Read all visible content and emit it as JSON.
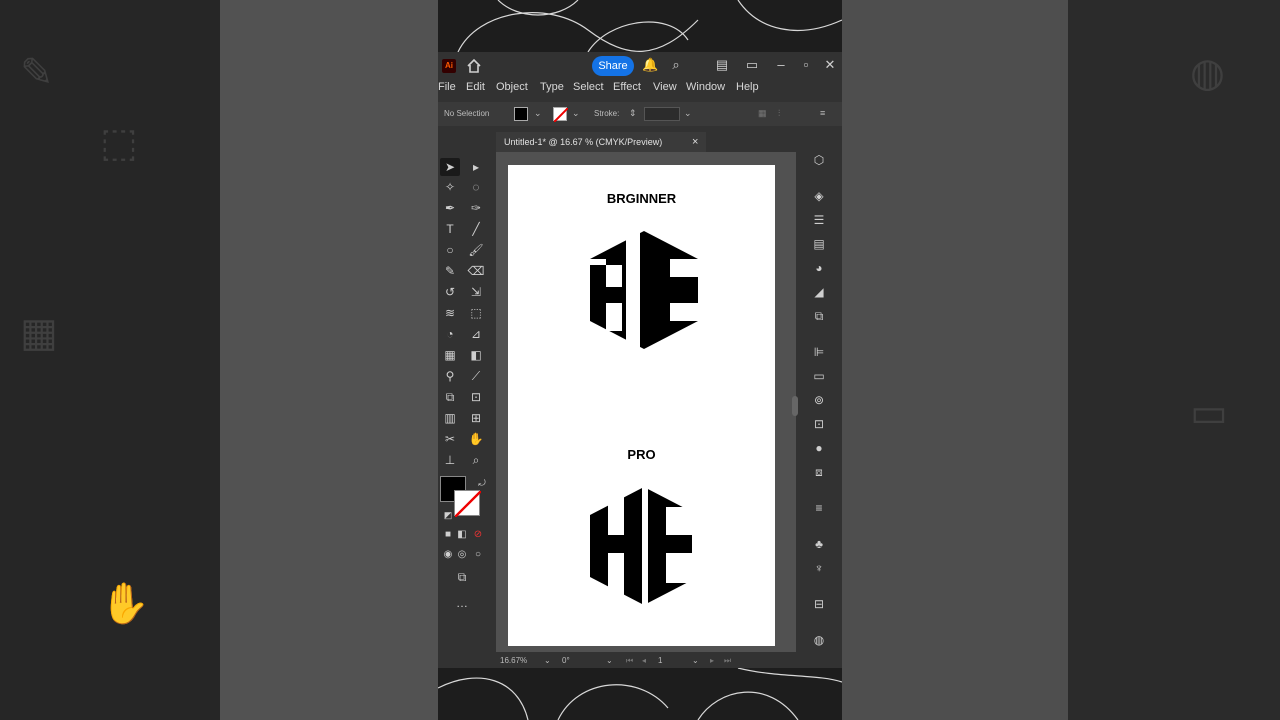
{
  "app": {
    "logo": "Ai",
    "share_label": "Share",
    "menu": [
      "File",
      "Edit",
      "Object",
      "Type",
      "Select",
      "Effect",
      "View",
      "Window",
      "Help"
    ]
  },
  "control_bar": {
    "selection": "No Selection",
    "stroke_label": "Stroke:"
  },
  "document": {
    "tab_title": "Untitled-1* @ 16.67 % (CMYK/Preview)",
    "close_glyph": "×"
  },
  "artboard": {
    "beginner_label": "BRGINNER",
    "pro_label": "PRO"
  },
  "status": {
    "zoom": "16.67%",
    "rotation": "0°",
    "artboard_number": "1"
  },
  "colors": {
    "share_blue": "#1473e6",
    "ai_orange": "#ff5a00",
    "panel": "#323232",
    "artboard": "#ffffff"
  }
}
